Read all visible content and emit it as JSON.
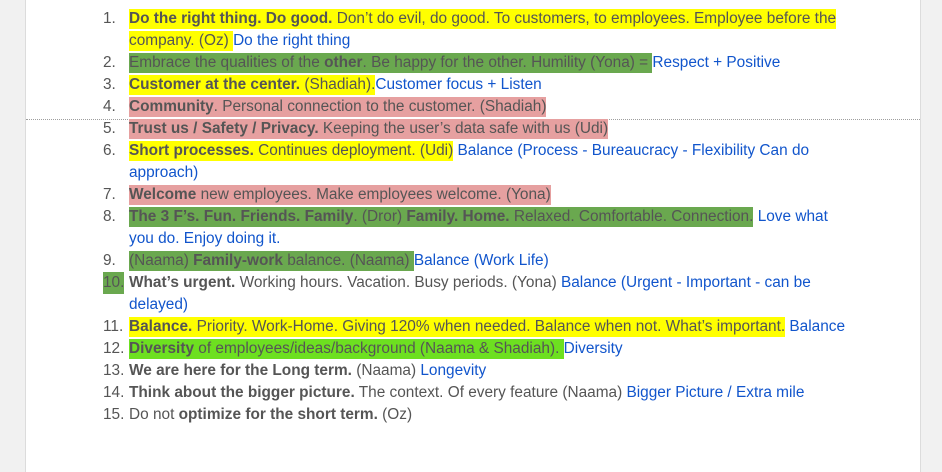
{
  "colors": {
    "yellow": "#ffff00",
    "green": "#6aa84f",
    "pink": "#e6a0a0",
    "bright_green": "#6de020",
    "text": "#555555",
    "link": "#1155cc"
  },
  "items": [
    {
      "num": "1.",
      "hl": "yellow",
      "segs": [
        {
          "t": "Do the right thing. Do good.",
          "b": true
        },
        {
          "t": " Don’t do evil, do good. To customers, to employees. Employee before the company. (Oz) "
        },
        {
          "t": "Do the right thing",
          "link": true,
          "nohl": true
        }
      ]
    },
    {
      "num": "2.",
      "hl": "green",
      "segs": [
        {
          "t": "Embrace the qualities of the "
        },
        {
          "t": "other",
          "b": true
        },
        {
          "t": ". Be happy for the other. Humility (Yona) = "
        },
        {
          "t": "Respect + Positive",
          "link": true,
          "nohl": true
        }
      ]
    },
    {
      "num": "3.",
      "hl": "yellow",
      "segs": [
        {
          "t": "Customer at the center.",
          "b": true
        },
        {
          "t": " (Shadiah)."
        },
        {
          "t": "Customer focus + Listen",
          "link": true,
          "nohl": true
        }
      ]
    },
    {
      "num": "4.",
      "hl": "pink",
      "segs": [
        {
          "t": "Community",
          "b": true
        },
        {
          "t": ". Personal connection to the customer. (Shadiah)"
        }
      ]
    },
    {
      "num": "5.",
      "hl": "pink",
      "segs": [
        {
          "t": "Trust us / Safety / Privacy.",
          "b": true
        },
        {
          "t": " Keeping the user’s data safe with us (Udi)"
        }
      ]
    },
    {
      "num": "6.",
      "hl": "yellow",
      "segs": [
        {
          "t": "Short processes.",
          "b": true
        },
        {
          "t": " Continues deployment. (Udi)"
        },
        {
          "t": " ",
          "nohl": true
        },
        {
          "t": "Balance (Process - Bureaucracy - Flexibility Can do approach)",
          "link": true,
          "nohl": true
        }
      ]
    },
    {
      "num": "7.",
      "hl": "pink",
      "segs": [
        {
          "t": "Welcome",
          "b": true
        },
        {
          "t": " new employees. Make employees welcome. (Yona)"
        }
      ]
    },
    {
      "num": "8.",
      "hl": "green",
      "segs": [
        {
          "t": "The 3 F’s.  Fun. Friends. Family",
          "b": true
        },
        {
          "t": ". (Dror) "
        },
        {
          "t": "Family. Home.",
          "b": true
        },
        {
          "t": " Relaxed. Comfortable. Connection."
        },
        {
          "t": " ",
          "nohl": true
        },
        {
          "t": "Love what you do. Enjoy doing it.",
          "link": true,
          "nohl": true
        }
      ]
    },
    {
      "num": "9.",
      "hl": "green",
      "segs": [
        {
          "t": "(Naama) "
        },
        {
          "t": "Family-work",
          "b": true
        },
        {
          "t": " balance. (Naama) "
        },
        {
          "t": "Balance (Work Life)",
          "link": true,
          "nohl": true
        }
      ]
    },
    {
      "num": "10.",
      "hl": "green",
      "numhl": true,
      "segs": [
        {
          "t": "What’s urgent.",
          "b": true,
          "nohl": true
        },
        {
          "t": " Working hours. Vacation. Busy periods. (Yona) ",
          "nohl": true
        },
        {
          "t": "Balance (Urgent - Important - can be delayed)",
          "link": true,
          "nohl": true
        }
      ]
    },
    {
      "num": "11.",
      "hl": "yellow",
      "segs": [
        {
          "t": "Balance.",
          "b": true
        },
        {
          "t": " Priority. Work-Home. Giving 120% when needed. Balance when not. What’s important."
        },
        {
          "t": " ",
          "nohl": true
        },
        {
          "t": "Balance",
          "link": true,
          "nohl": true
        }
      ]
    },
    {
      "num": "12.",
      "hl": "bright_green",
      "segs": [
        {
          "t": "Diversity",
          "b": true
        },
        {
          "t": " of employees/ideas/background  (Naama & Shadiah). "
        },
        {
          "t": "Diversity",
          "link": true,
          "nohl": true
        }
      ]
    },
    {
      "num": "13.",
      "hl": "none",
      "segs": [
        {
          "t": "We are here for the Long term.",
          "b": true
        },
        {
          "t": " (Naama)  "
        },
        {
          "t": "Longevity",
          "link": true
        }
      ]
    },
    {
      "num": "14.",
      "hl": "none",
      "segs": [
        {
          "t": "Think about the bigger picture.",
          "b": true
        },
        {
          "t": " The context. Of every feature (Naama) "
        },
        {
          "t": "Bigger Picture / Extra mile",
          "link": true
        }
      ]
    },
    {
      "num": "15.",
      "hl": "none",
      "segs": [
        {
          "t": "Do not "
        },
        {
          "t": "optimize for the short term.",
          "b": true
        },
        {
          "t": " (Oz)"
        }
      ]
    }
  ]
}
